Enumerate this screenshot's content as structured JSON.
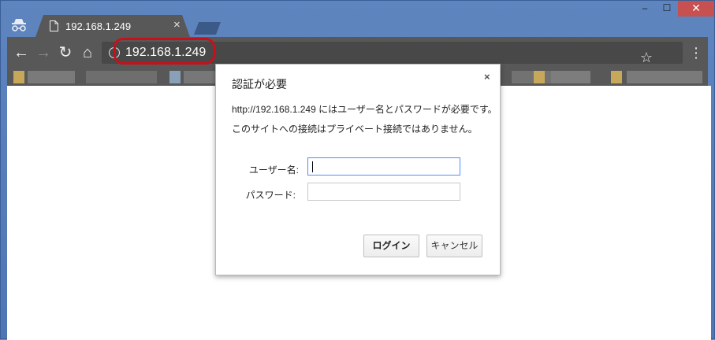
{
  "window": {
    "controls": {
      "minimize": "–",
      "maximize": "☐",
      "close": "✕"
    }
  },
  "tab": {
    "title": "192.168.1.249",
    "close": "×"
  },
  "toolbar": {
    "back": "←",
    "forward": "→",
    "reload": "↻",
    "home": "⌂",
    "url": "192.168.1.249",
    "info": "i",
    "star": "☆",
    "menu": "⋮"
  },
  "dialog": {
    "title": "認証が必要",
    "close": "×",
    "message_line1": "http://192.168.1.249 にはユーザー名とパスワードが必要です。",
    "message_line2": "このサイトへの接続はプライベート接続ではありません。",
    "username_label": "ユーザー名:",
    "username_value": "",
    "password_label": "パスワード:",
    "password_value": "",
    "login_button": "ログイン",
    "cancel_button": "キャンセル"
  },
  "colors": {
    "window_frame": "#5f85bf",
    "toolbar": "#585858",
    "omnibox": "#484848",
    "highlight": "#c8101a",
    "close_button": "#c75050",
    "focus_border": "#4d90fe"
  }
}
